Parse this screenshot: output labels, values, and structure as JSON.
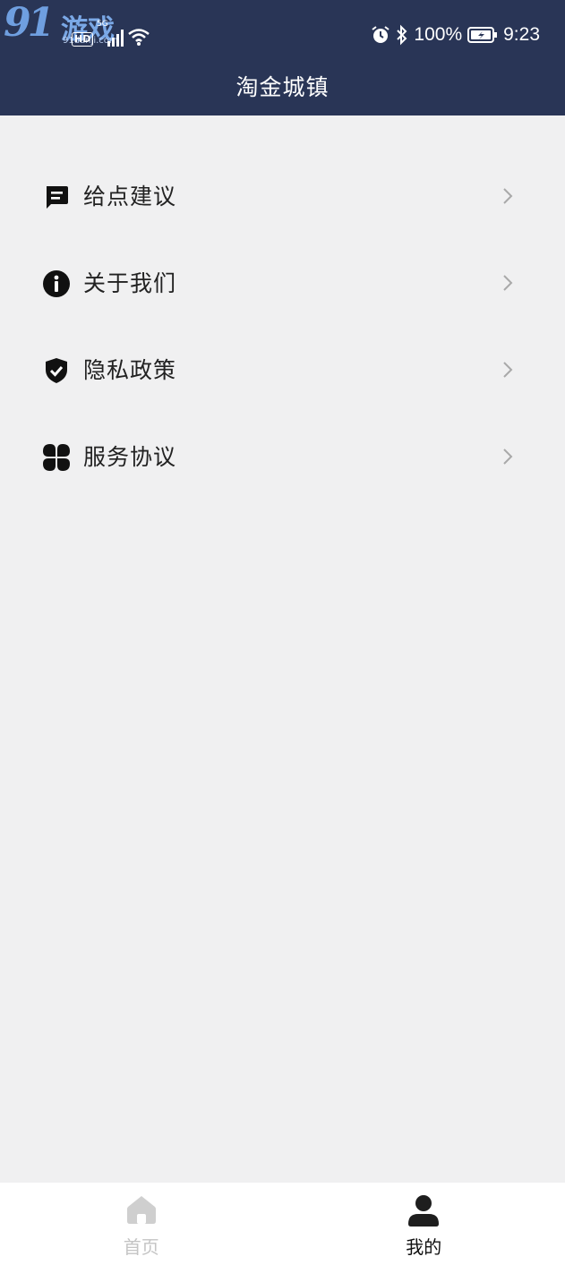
{
  "watermark": {
    "number": "91",
    "text": "游戏",
    "url": "91danji.com"
  },
  "status_bar": {
    "hd": "HD",
    "network": "5G",
    "battery": "100%",
    "time": "9:23"
  },
  "header": {
    "title": "淘金城镇"
  },
  "menu": {
    "items": [
      {
        "label": "给点建议",
        "icon": "feedback-icon"
      },
      {
        "label": "关于我们",
        "icon": "info-icon"
      },
      {
        "label": "隐私政策",
        "icon": "shield-check-icon"
      },
      {
        "label": "服务协议",
        "icon": "clover-icon"
      }
    ]
  },
  "tabbar": {
    "items": [
      {
        "label": "首页",
        "icon": "home-icon",
        "active": false
      },
      {
        "label": "我的",
        "icon": "user-icon",
        "active": true
      }
    ]
  },
  "colors": {
    "header_bg": "#293556",
    "page_bg": "#f0f0f1",
    "active_tab": "#111111",
    "inactive_tab": "#c4c4c4"
  }
}
